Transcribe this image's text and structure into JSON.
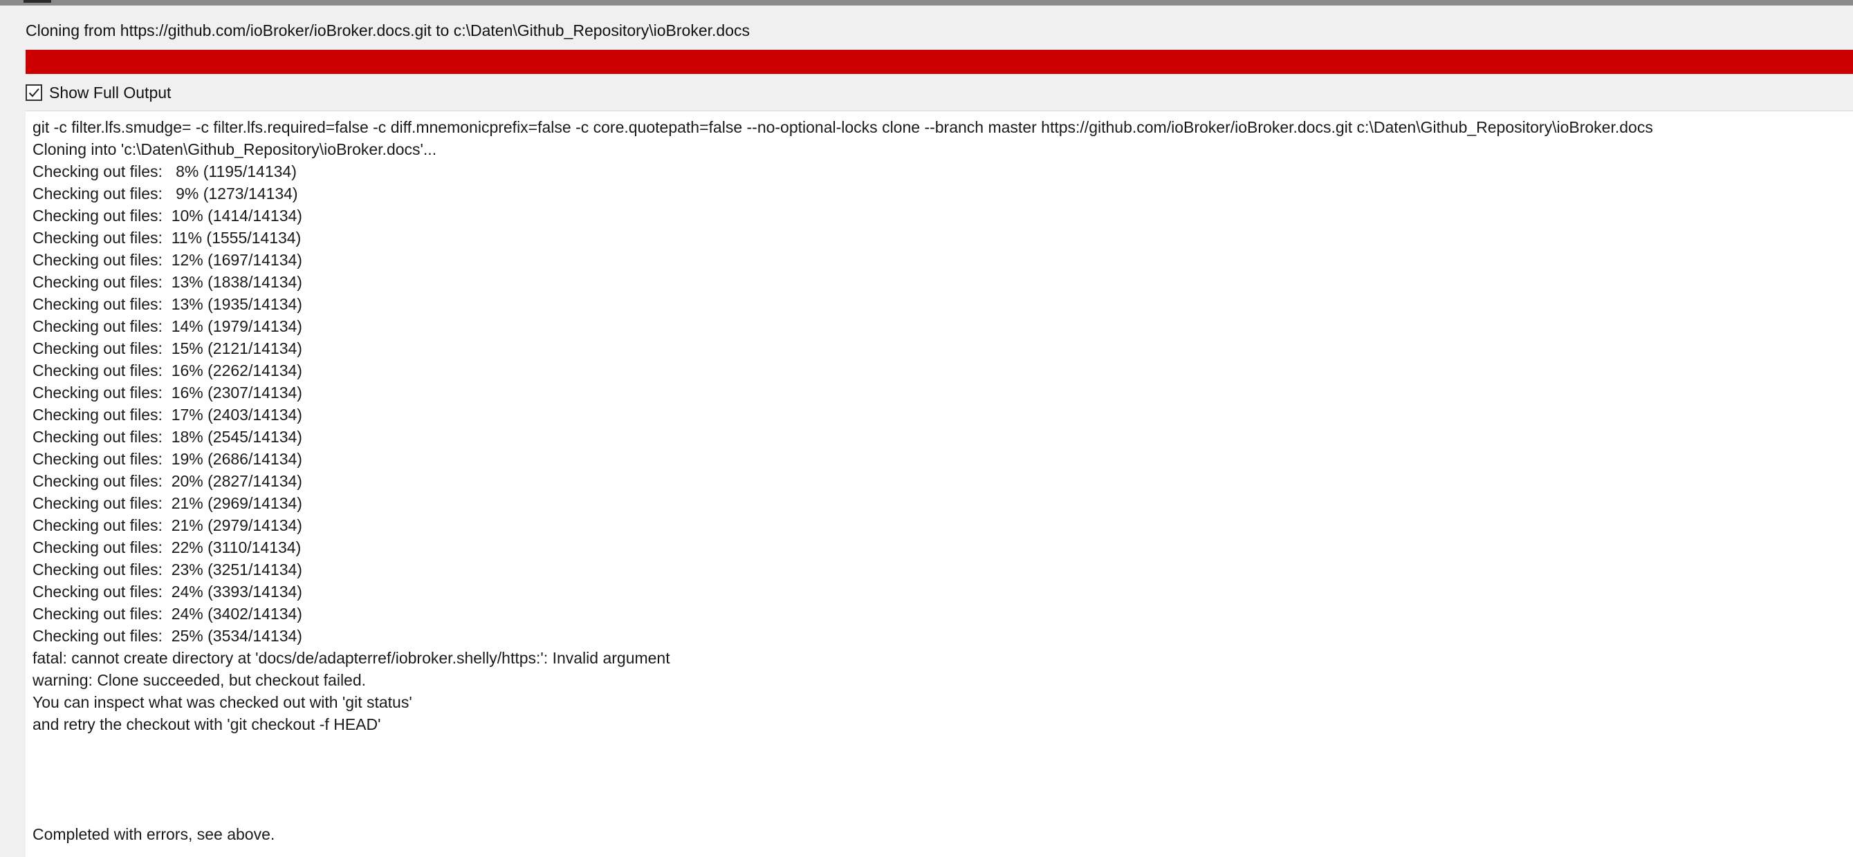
{
  "dialog": {
    "title": "Cloning from https://github.com/ioBroker/ioBroker.docs.git to c:\\Daten\\Github_Repository\\ioBroker.docs",
    "progress_fraction": 1.0,
    "progress_color": "#cc0000",
    "show_full_output": {
      "label": "Show Full Output",
      "checked": true
    }
  },
  "output": {
    "lines": [
      "git -c filter.lfs.smudge= -c filter.lfs.required=false -c diff.mnemonicprefix=false -c core.quotepath=false --no-optional-locks clone --branch master https://github.com/ioBroker/ioBroker.docs.git c:\\Daten\\Github_Repository\\ioBroker.docs",
      "Cloning into 'c:\\Daten\\Github_Repository\\ioBroker.docs'...",
      "Checking out files:   8% (1195/14134)",
      "Checking out files:   9% (1273/14134)",
      "Checking out files:  10% (1414/14134)",
      "Checking out files:  11% (1555/14134)",
      "Checking out files:  12% (1697/14134)",
      "Checking out files:  13% (1838/14134)",
      "Checking out files:  13% (1935/14134)",
      "Checking out files:  14% (1979/14134)",
      "Checking out files:  15% (2121/14134)",
      "Checking out files:  16% (2262/14134)",
      "Checking out files:  16% (2307/14134)",
      "Checking out files:  17% (2403/14134)",
      "Checking out files:  18% (2545/14134)",
      "Checking out files:  19% (2686/14134)",
      "Checking out files:  20% (2827/14134)",
      "Checking out files:  21% (2969/14134)",
      "Checking out files:  21% (2979/14134)",
      "Checking out files:  22% (3110/14134)",
      "Checking out files:  23% (3251/14134)",
      "Checking out files:  24% (3393/14134)",
      "Checking out files:  24% (3402/14134)",
      "Checking out files:  25% (3534/14134)",
      "fatal: cannot create directory at 'docs/de/adapterref/iobroker.shelly/https:': Invalid argument",
      "warning: Clone succeeded, but checkout failed.",
      "You can inspect what was checked out with 'git status'",
      "and retry the checkout with 'git checkout -f HEAD'"
    ],
    "completion": "Completed with errors, see above."
  }
}
